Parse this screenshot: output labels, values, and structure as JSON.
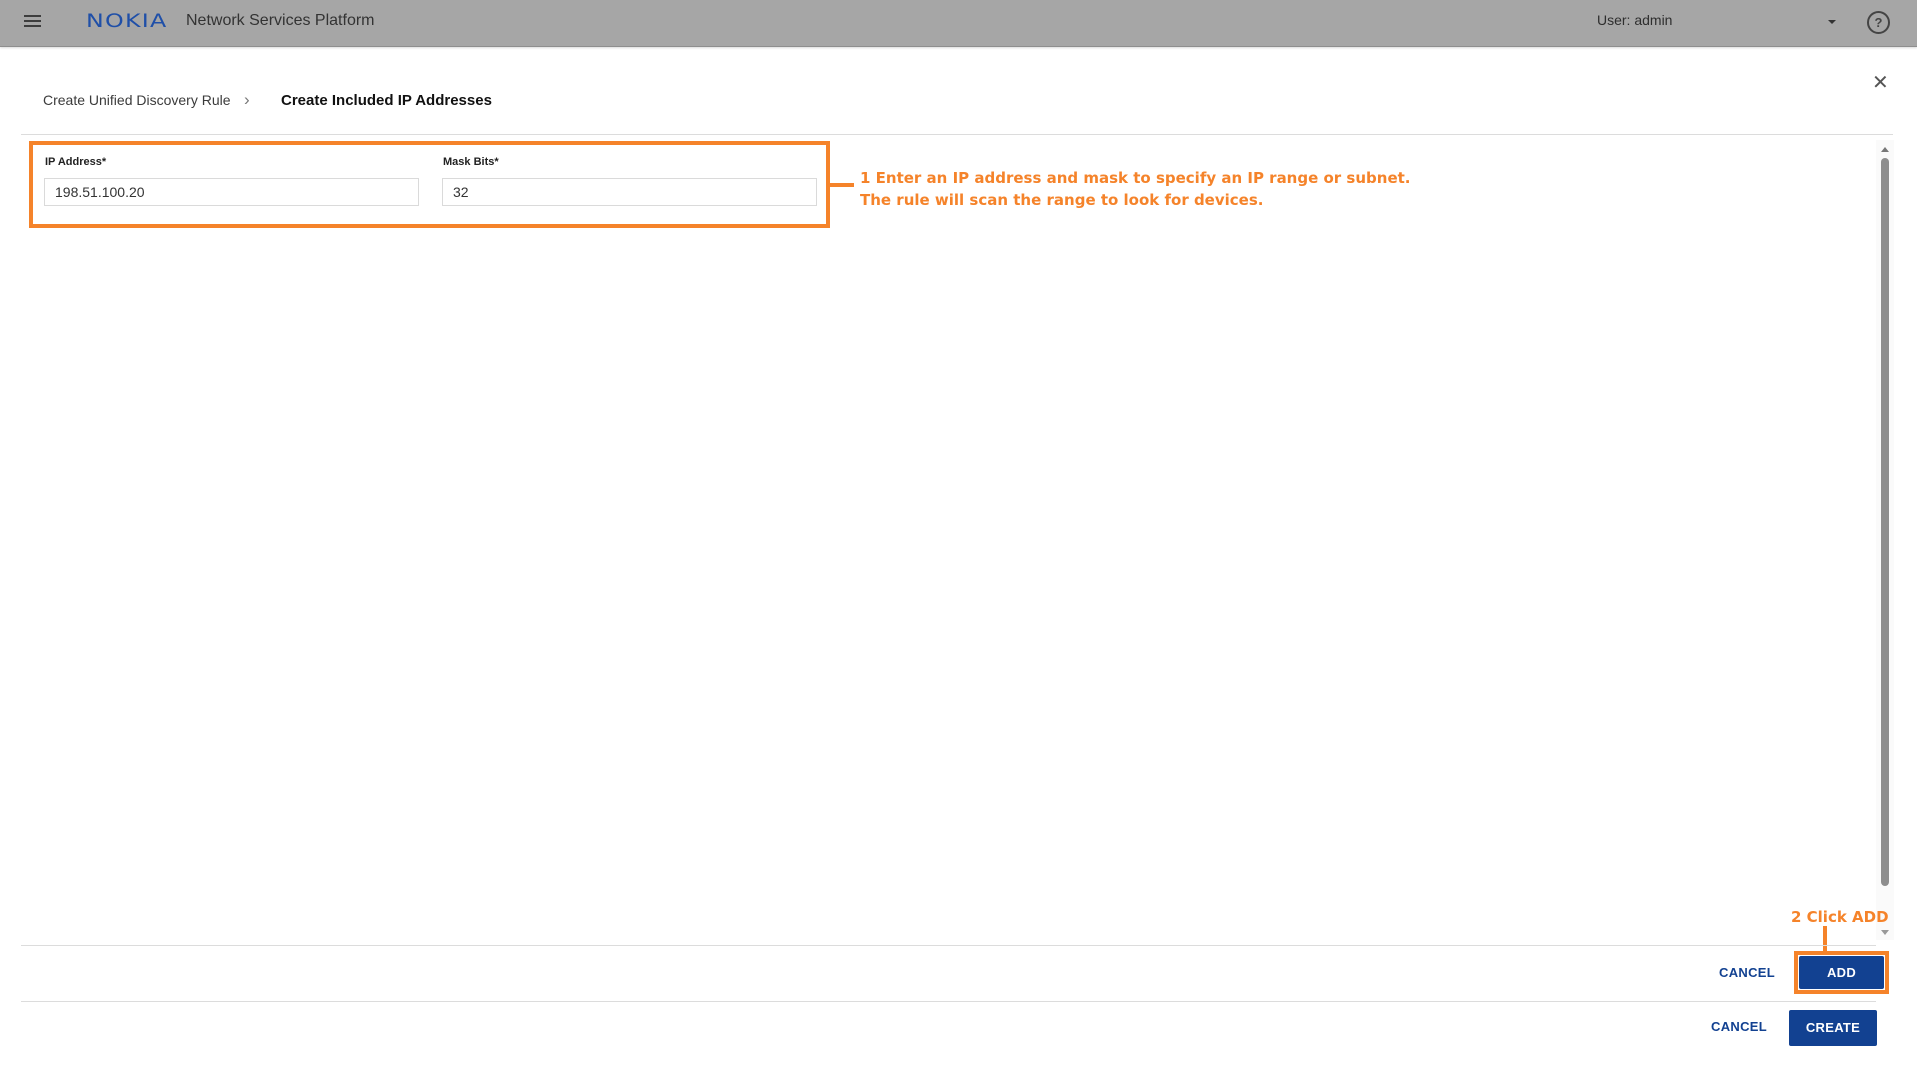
{
  "header": {
    "menu_icon": "hamburger-menu-icon",
    "logo": "NOKIA",
    "app_title": "Network Services Platform",
    "user_label": "User: admin",
    "user_menu_icon": "caret-down-icon",
    "help_icon": "?"
  },
  "breadcrumb": {
    "parent": "Create Unified Discovery Rule",
    "separator": "›",
    "current": "Create Included IP Addresses"
  },
  "dialog": {
    "close_icon": "✕"
  },
  "form": {
    "ip_address": {
      "label": "IP Address*",
      "value": "198.51.100.20"
    },
    "mask_bits": {
      "label": "Mask Bits*",
      "value": "32"
    }
  },
  "annotations": {
    "step1_line1": "1  Enter an IP address and mask to specify an IP range or subnet.",
    "step1_line2": "The rule will scan the range to look for devices.",
    "step2": "2  Click ADD",
    "color": "#f5832a"
  },
  "inner_footer": {
    "cancel_label": "CANCEL",
    "add_label": "ADD"
  },
  "outer_footer": {
    "cancel_label": "CANCEL",
    "create_label": "CREATE"
  },
  "colors": {
    "primary": "#124191",
    "header_bg": "#a6a6a6",
    "highlight": "#f5832a"
  }
}
